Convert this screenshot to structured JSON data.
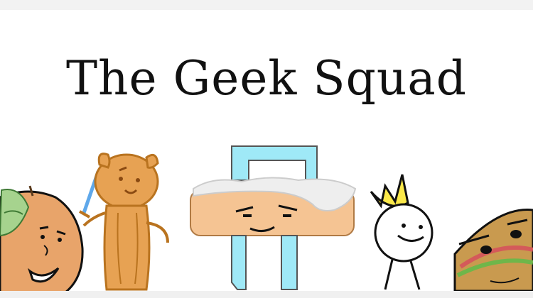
{
  "title": "The Geek Squad",
  "colors": {
    "background": "#ffffff",
    "title_text": "#111111",
    "peach_body": "#e8a46a",
    "bear_fill": "#e7a253",
    "bear_outline": "#b9731f",
    "sword_blue": "#5fa8ea",
    "ruler_tan": "#f5c493",
    "ruler_frosting": "#eeeeee",
    "cyan_pipe": "#9fe9f7",
    "crown_yellow": "#fbe94a",
    "sandwich_bread": "#c99a4f",
    "lettuce_green": "#6fb64a",
    "leaf_green": "#a6d38e"
  },
  "characters": [
    {
      "icon": "peach-character-icon"
    },
    {
      "icon": "bear-with-sword-character-icon"
    },
    {
      "icon": "ruler-cake-character-icon"
    },
    {
      "icon": "crowned-stickman-character-icon"
    },
    {
      "icon": "sandwich-character-icon"
    }
  ]
}
